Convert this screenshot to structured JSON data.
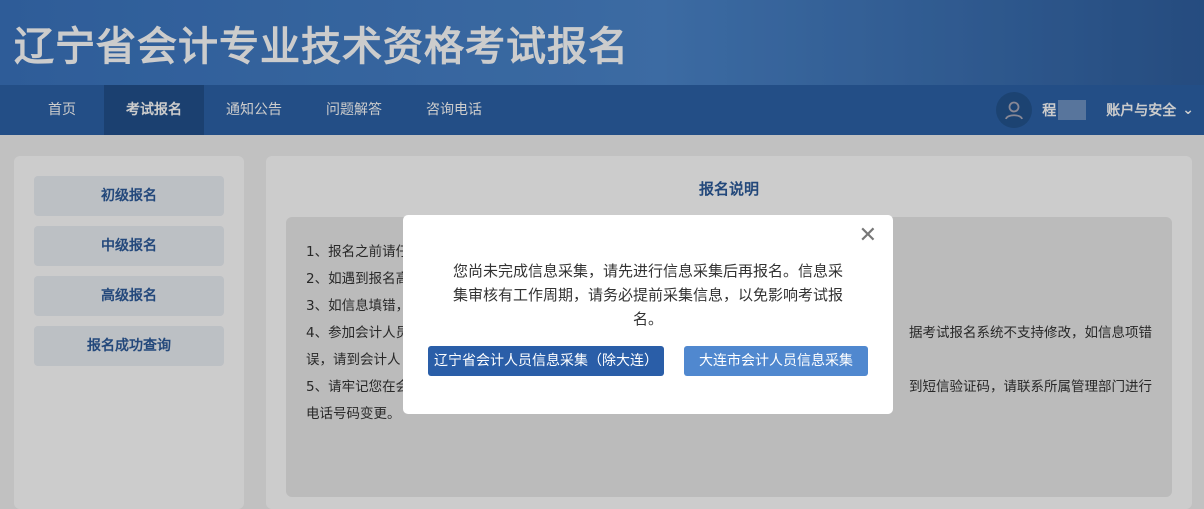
{
  "header": {
    "title": "辽宁省会计专业技术资格考试报名"
  },
  "nav": {
    "items": [
      "首页",
      "考试报名",
      "通知公告",
      "问题解答",
      "咨询电话"
    ],
    "user_name": "程",
    "account": "账户与安全"
  },
  "sidebar": {
    "items": [
      "初级报名",
      "中级报名",
      "高级报名",
      "报名成功查询"
    ]
  },
  "main": {
    "title": "报名说明",
    "notes": [
      {
        "left": "1、报名之前请仔",
        "right": ""
      },
      {
        "left": "2、如遇到报名高",
        "right": ""
      },
      {
        "left": "3、如信息填错，",
        "right": ""
      },
      {
        "left": "4、参加会计人员",
        "right": "据考试报名系统不支持修改，如信息项错"
      },
      {
        "left": "误，请到会计人",
        "right": ""
      },
      {
        "left": "5、请牢记您在会",
        "right": "到短信验证码，请联系所属管理部门进行"
      },
      {
        "left": "电话号码变更。",
        "right": ""
      }
    ]
  },
  "modal": {
    "message": "您尚未完成信息采集，请先进行信息采集后再报名。信息采集审核有工作周期，请务必提前采集信息，以免影响考试报名。",
    "btn_liaoning": "辽宁省会计人员信息采集（除大连）",
    "btn_dalian": "大连市会计人员信息采集",
    "close": "✕"
  }
}
